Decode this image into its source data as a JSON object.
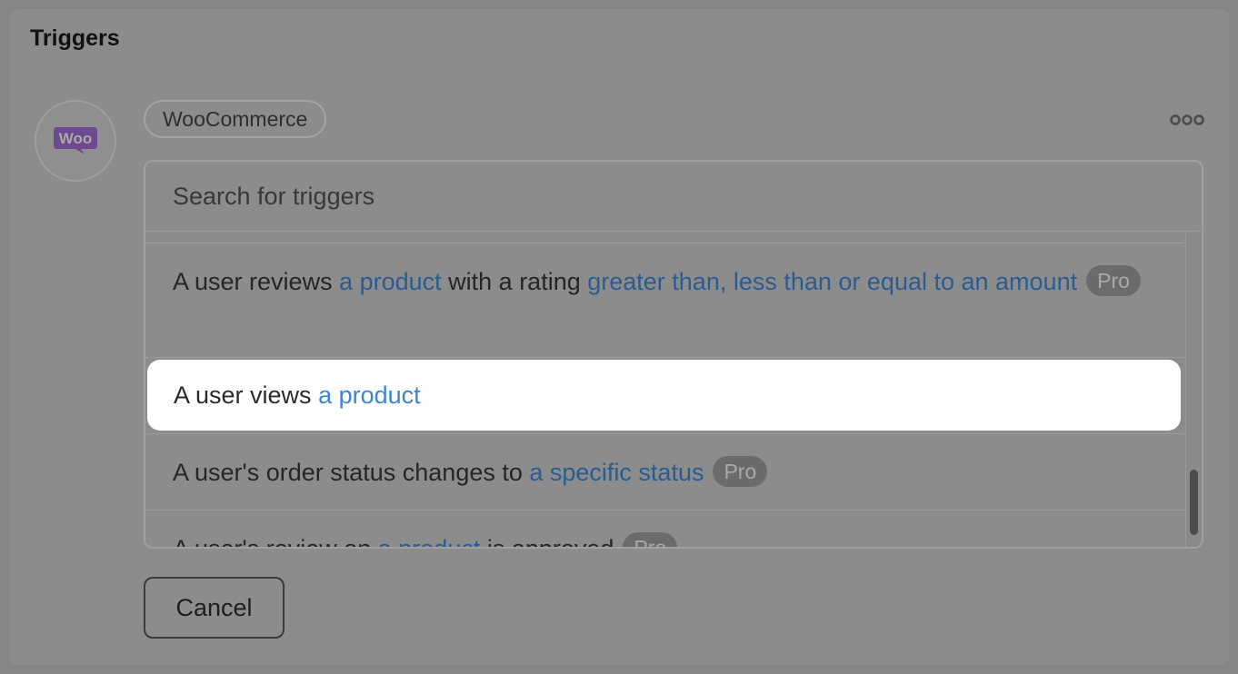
{
  "panel": {
    "title": "Triggers"
  },
  "integration": {
    "name": "WooCommerce",
    "logo_icon": "woocommerce-logo-icon",
    "logo_text": "Woo",
    "logo_color": "#7f54b3"
  },
  "menu": {
    "more_icon": "more-horizontal-icon"
  },
  "search": {
    "placeholder": "Search for triggers",
    "value": ""
  },
  "triggers": [
    {
      "parts": [
        {
          "text": "A user reviews ",
          "link": false
        },
        {
          "text": "a product",
          "link": true
        },
        {
          "text": " with a rating ",
          "link": false
        },
        {
          "text": "greater than, less than or equal to an amount",
          "link": true
        }
      ],
      "badge": "Pro",
      "highlighted": false
    },
    {
      "parts": [
        {
          "text": "A user views ",
          "link": false
        },
        {
          "text": "a product",
          "link": true
        }
      ],
      "badge": "",
      "highlighted": true
    },
    {
      "parts": [
        {
          "text": "A user's order status changes to ",
          "link": false
        },
        {
          "text": "a specific status",
          "link": true
        }
      ],
      "badge": "Pro",
      "highlighted": false
    },
    {
      "parts": [
        {
          "text": "A user's review on ",
          "link": false
        },
        {
          "text": "a product",
          "link": true
        },
        {
          "text": " is approved",
          "link": false
        }
      ],
      "badge": "Pro",
      "highlighted": false
    }
  ],
  "actions": {
    "cancel_label": "Cancel"
  },
  "colors": {
    "link": "#2a5c92",
    "link_highlighted": "#3b86d3",
    "overlay": "#8c8c8c",
    "highlight_bg": "#ffffff"
  }
}
